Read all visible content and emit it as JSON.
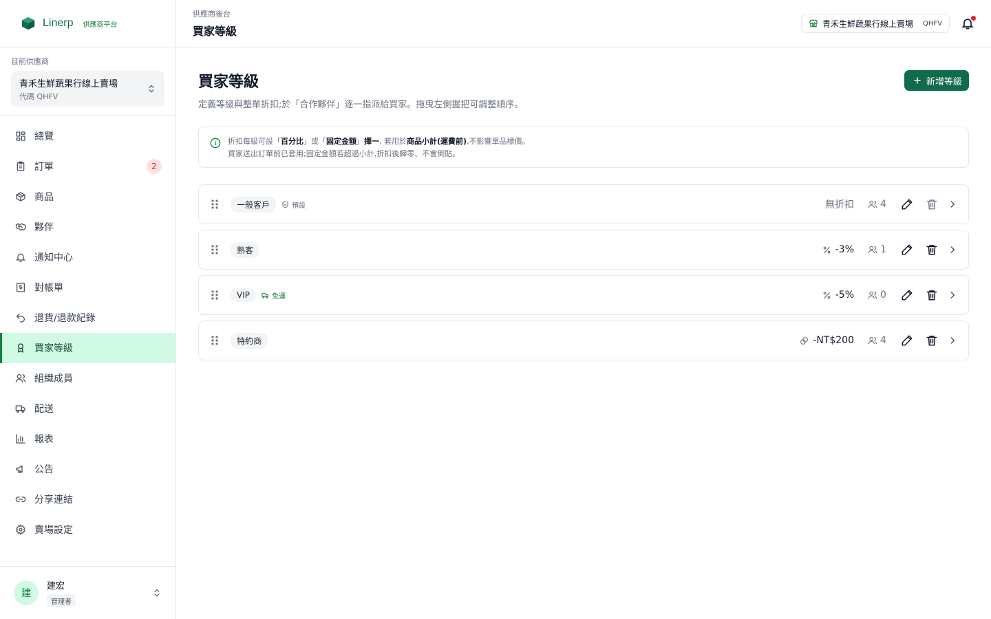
{
  "brand": {
    "name": "Linerp",
    "tag": "供應商平台",
    "color": "#0f6b4a"
  },
  "supplier": {
    "label": "目前供應商",
    "name": "青禾生鮮蔬果行線上賣場",
    "code": "代碼 QHFV"
  },
  "nav": [
    {
      "label": "總覽",
      "icon": "grid-icon"
    },
    {
      "label": "訂單",
      "icon": "clipboard-icon",
      "badge": "2"
    },
    {
      "label": "商品",
      "icon": "box-icon"
    },
    {
      "label": "夥伴",
      "icon": "handshake-icon"
    },
    {
      "label": "通知中心",
      "icon": "bell-icon"
    },
    {
      "label": "對帳單",
      "icon": "receipt-icon"
    },
    {
      "label": "退貨/退款紀錄",
      "icon": "undo-icon"
    },
    {
      "label": "買家等級",
      "icon": "award-icon",
      "active": true
    },
    {
      "label": "組織成員",
      "icon": "users-icon"
    },
    {
      "label": "配送",
      "icon": "truck-icon"
    },
    {
      "label": "報表",
      "icon": "bar-chart-icon"
    },
    {
      "label": "公告",
      "icon": "megaphone-icon"
    },
    {
      "label": "分享連結",
      "icon": "link-icon"
    },
    {
      "label": "賣場設定",
      "icon": "gear-icon"
    }
  ],
  "user": {
    "initial": "建",
    "name": "建宏",
    "role": "管理者"
  },
  "topbar": {
    "breadcrumb": "供應商後台",
    "title": "買家等級",
    "store_name": "青禾生鮮蔬果行線上賣場",
    "store_code": "QHFV"
  },
  "page": {
    "title": "買家等級",
    "description": "定義等級與整單折扣;於「合作夥伴」逐一指派給買家。拖曳左側握把可調整順序。",
    "add_button": "新增等級"
  },
  "info": {
    "line1": {
      "a": "折扣每級可設「",
      "b": "百分比",
      "c": "」或「",
      "d": "固定金額",
      "e": "」",
      "f": "擇一",
      "g": ", 套用於",
      "h": "商品小計(運費前)",
      "i": ",不影響單品標價。"
    },
    "line2": "買家送出訂單前已套用;固定金額若超過小計,折扣後歸零、不會倒貼。"
  },
  "tiers": [
    {
      "name": "一般客戶",
      "tag": "預設",
      "tag_type": "default",
      "discount": "無折扣",
      "discount_type": "none",
      "members": "4",
      "deletable": false
    },
    {
      "name": "熟客",
      "tag": "",
      "tag_type": "",
      "discount": "-3%",
      "discount_type": "percent",
      "members": "1",
      "deletable": true
    },
    {
      "name": "VIP",
      "tag": "免運",
      "tag_type": "ship",
      "discount": "-5%",
      "discount_type": "percent",
      "members": "0",
      "deletable": true
    },
    {
      "name": "特約商",
      "tag": "",
      "tag_type": "",
      "discount": "-NT$200",
      "discount_type": "fixed",
      "members": "4",
      "deletable": true
    }
  ]
}
